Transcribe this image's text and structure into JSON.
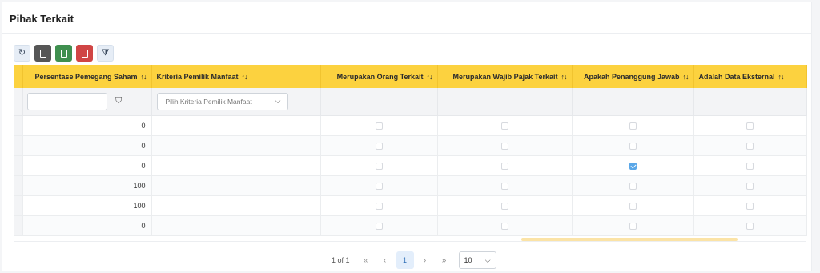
{
  "panel": {
    "title": "Pihak Terkait"
  },
  "toolbar": {
    "buttons": [
      {
        "name": "reload",
        "icon": "refresh-icon",
        "glyph": "↻",
        "color": "#e6edf6"
      },
      {
        "name": "export",
        "icon": "document-icon",
        "color": "#565656"
      },
      {
        "name": "excel",
        "icon": "excel-icon",
        "color": "#3f8f4f"
      },
      {
        "name": "pdf",
        "icon": "pdf-icon",
        "color": "#d04545"
      },
      {
        "name": "clear-filter",
        "icon": "filter-clear-icon",
        "glyph": "⧩",
        "color": "#e6edf6"
      }
    ]
  },
  "table": {
    "sort_glyph": "↑↓",
    "columns": [
      "Persentase Pemegang Saham",
      "Kriteria Pemilik Manfaat",
      "Merupakan Orang Terkait",
      "Merupakan Wajib Pajak Terkait",
      "Apakah Penanggung Jawab",
      "Adalah Data Eksternal"
    ],
    "filter": {
      "input_value": "",
      "filter_icon": "⛉",
      "dropdown_placeholder": "Pilih Kriteria Pemilik Manfaat",
      "dropdown_chevron": "⌵"
    },
    "rows": [
      {
        "persentase": "0",
        "kriteria": "",
        "orang_terkait": false,
        "wajib_pajak": false,
        "penanggung_jawab": false,
        "data_eksternal": false
      },
      {
        "persentase": "0",
        "kriteria": "",
        "orang_terkait": false,
        "wajib_pajak": false,
        "penanggung_jawab": false,
        "data_eksternal": false
      },
      {
        "persentase": "0",
        "kriteria": "",
        "orang_terkait": false,
        "wajib_pajak": false,
        "penanggung_jawab": true,
        "data_eksternal": false
      },
      {
        "persentase": "100",
        "kriteria": "",
        "orang_terkait": false,
        "wajib_pajak": false,
        "penanggung_jawab": false,
        "data_eksternal": false
      },
      {
        "persentase": "100",
        "kriteria": "",
        "orang_terkait": false,
        "wajib_pajak": false,
        "penanggung_jawab": false,
        "data_eksternal": false
      },
      {
        "persentase": "0",
        "kriteria": "",
        "orang_terkait": false,
        "wajib_pajak": false,
        "penanggung_jawab": false,
        "data_eksternal": false
      }
    ]
  },
  "pager": {
    "info": "1 of 1",
    "first": "«",
    "prev": "‹",
    "current_page": "1",
    "next": "›",
    "last": "»",
    "page_size": "10",
    "page_size_chevron": "⌵"
  },
  "colors": {
    "header": "#fcd23f",
    "accent": "#5aa7e8"
  }
}
